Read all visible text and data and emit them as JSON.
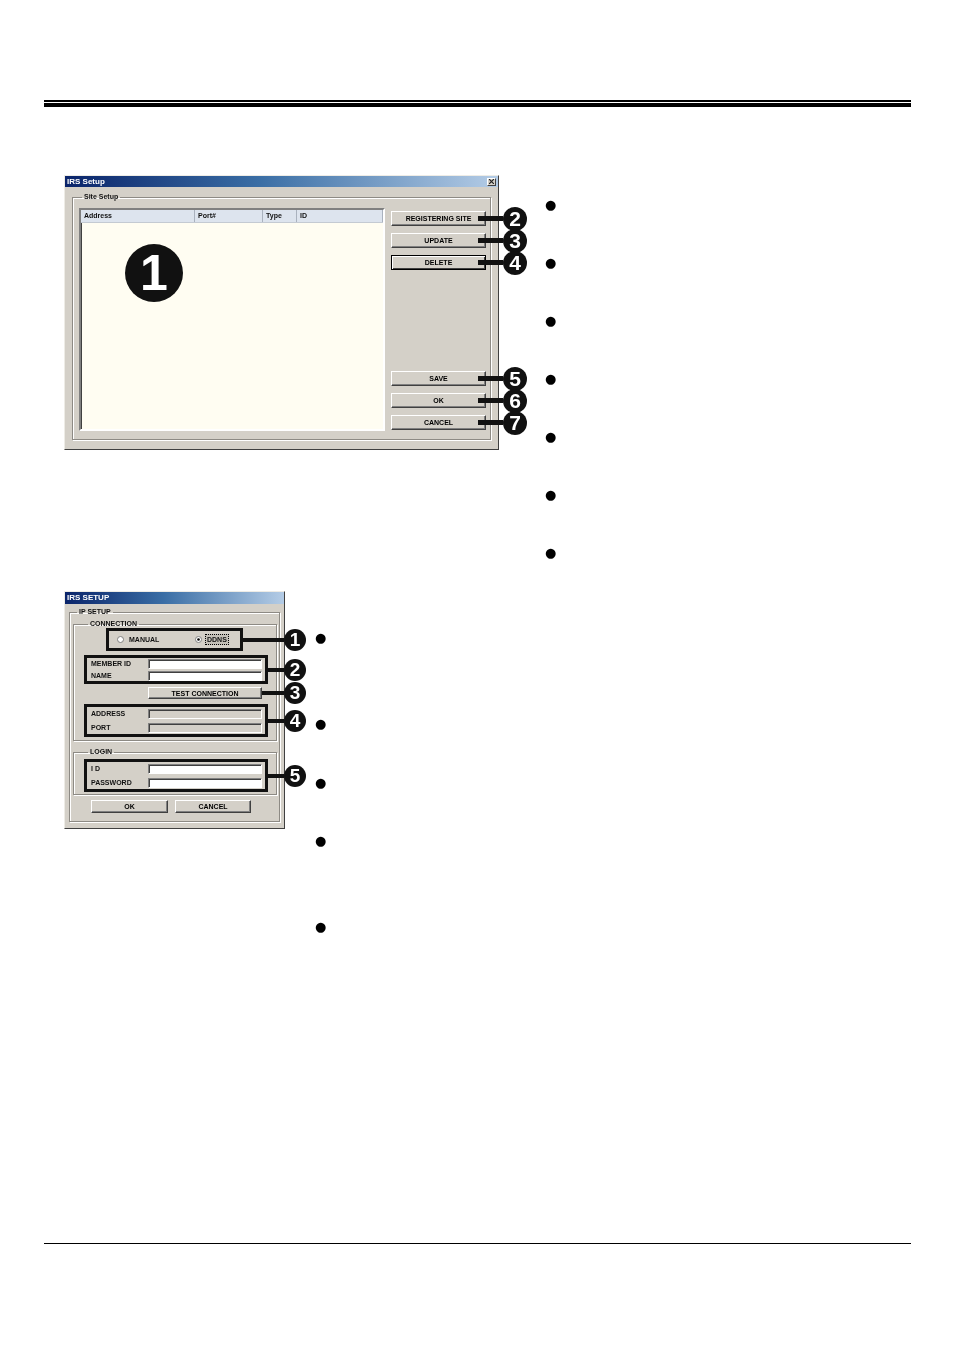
{
  "site_setup_dialog": {
    "title": "IRS Setup",
    "group_label": "Site Setup",
    "columns": [
      "Address",
      "Port#",
      "Type",
      "ID"
    ],
    "list_callout": "1",
    "action_buttons": [
      {
        "label": "REGISTERING SITE",
        "callout": "2",
        "focused": false
      },
      {
        "label": "UPDATE",
        "callout": "3",
        "focused": false
      },
      {
        "label": "DELETE",
        "callout": "4",
        "focused": true
      }
    ],
    "confirm_buttons": [
      {
        "label": "SAVE",
        "callout": "5",
        "focused": false
      },
      {
        "label": "OK",
        "callout": "6",
        "focused": false
      },
      {
        "label": "CANCEL",
        "callout": "7",
        "focused": false
      }
    ]
  },
  "site_setup_bullets": [
    "●",
    "●",
    "●",
    "●",
    "●",
    "●",
    "●"
  ],
  "ip_setup_dialog": {
    "title": "IRS SETUP",
    "group_label": "IP SETUP",
    "connection": {
      "label": "CONNECTION",
      "mode": {
        "callout": "1",
        "radios": [
          {
            "label": "MANUAL",
            "selected": false,
            "focused": false
          },
          {
            "label": "DDNS",
            "selected": true,
            "focused": true
          }
        ]
      },
      "member": {
        "callout": "2",
        "fields": [
          {
            "label": "MEMBER ID",
            "disabled": false
          },
          {
            "label": "NAME",
            "disabled": false
          }
        ]
      },
      "test_button": {
        "label": "TEST CONNECTION",
        "callout": "3"
      },
      "server": {
        "callout": "4",
        "fields": [
          {
            "label": "ADDRESS",
            "disabled": true
          },
          {
            "label": "PORT",
            "disabled": true
          }
        ]
      }
    },
    "login": {
      "label": "LOGIN",
      "callout": "5",
      "fields": [
        {
          "label": "I D",
          "disabled": false
        },
        {
          "label": "PASSWORD",
          "disabled": false
        }
      ]
    },
    "buttons": [
      "OK",
      "CANCEL"
    ]
  },
  "ip_setup_bullets": [
    "●",
    "●",
    "●",
    "●",
    "●"
  ]
}
